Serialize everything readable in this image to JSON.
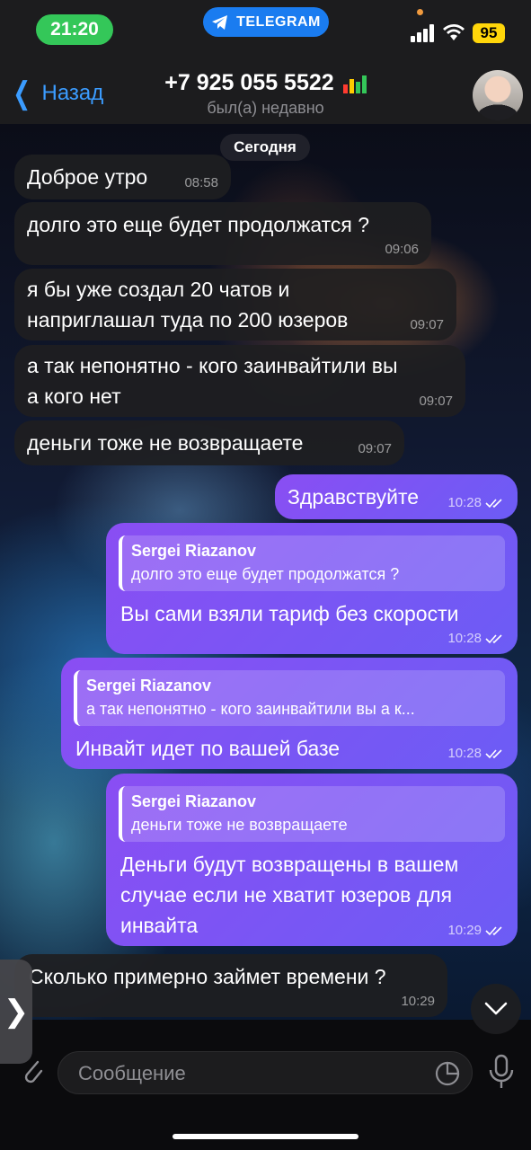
{
  "status_bar": {
    "time": "21:20",
    "app_pill": "TELEGRAM",
    "battery": "95"
  },
  "header": {
    "back_label": "Назад",
    "contact_name": "+7 925 055 5522",
    "contact_status": "был(а) недавно"
  },
  "date_divider": "Сегодня",
  "messages": [
    {
      "direction": "in",
      "text": "Доброе утро",
      "time": "08:58"
    },
    {
      "direction": "in",
      "text": "долго это еще будет продолжатся ?",
      "time": "09:06"
    },
    {
      "direction": "in",
      "text": "я бы уже создал 20 чатов и\nнаприглашал туда по 200 юзеров",
      "time": "09:07"
    },
    {
      "direction": "in",
      "text": "а так непонятно - кого заинвайтили вы\nа кого нет",
      "time": "09:07"
    },
    {
      "direction": "in",
      "text": "деньги тоже не возвращаете",
      "time": "09:07"
    },
    {
      "direction": "out",
      "text": "Здравствуйте",
      "time": "10:28"
    },
    {
      "direction": "out",
      "reply_name": "Sergei Riazanov",
      "reply_text": "долго это еще будет продолжатся ?",
      "text": "Вы сами взяли тариф без скорости",
      "time": "10:28"
    },
    {
      "direction": "out",
      "reply_name": "Sergei Riazanov",
      "reply_text": "а так непонятно - кого заинвайтили вы а к...",
      "text": "Инвайт идет по вашей базе",
      "time": "10:28"
    },
    {
      "direction": "out",
      "reply_name": "Sergei Riazanov",
      "reply_text": "деньги тоже не возвращаете",
      "text": "Деньги будут возвращены в вашем\nслучае если не хватит юзеров для\nинвайта",
      "time": "10:29"
    },
    {
      "direction": "in",
      "text": "Сколько примерно займет времени ?",
      "time": "10:29"
    }
  ],
  "composer": {
    "placeholder": "Сообщение"
  },
  "colors": {
    "accent": "#3b9cff",
    "outgoing_start": "#8a4ef3",
    "outgoing_end": "#6c5cf5",
    "status_green": "#34c759",
    "battery_yellow": "#ffd60a"
  },
  "icons": [
    "telegram-icon",
    "signal-icon",
    "wifi-icon",
    "chevron-left-icon",
    "signal-bars-icon",
    "read-check-icon",
    "chevron-down-icon",
    "chevron-right-icon",
    "attach-icon",
    "sticker-icon",
    "mic-icon"
  ]
}
